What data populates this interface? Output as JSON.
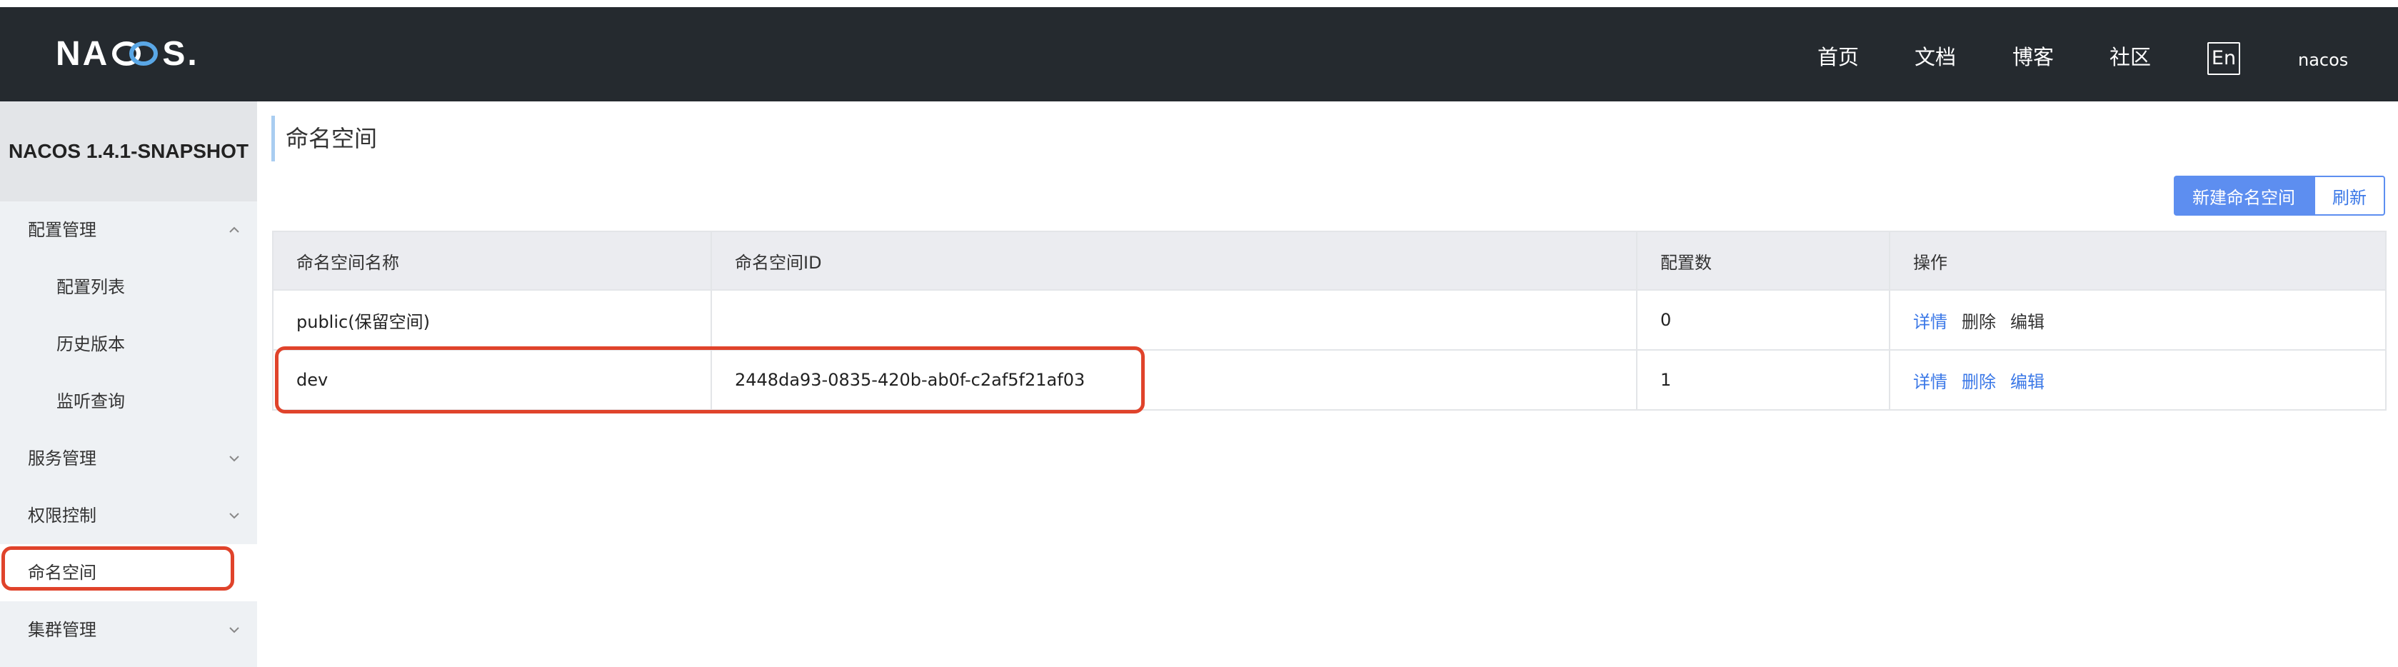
{
  "header": {
    "logo": "NACOS.",
    "nav": [
      "首页",
      "文档",
      "博客",
      "社区"
    ],
    "lang": "En",
    "user": "nacos"
  },
  "sidebar": {
    "version": "NACOS 1.4.1-SNAPSHOT",
    "items": [
      {
        "label": "配置管理",
        "expanded": true
      },
      {
        "label": "配置列表"
      },
      {
        "label": "历史版本"
      },
      {
        "label": "监听查询"
      },
      {
        "label": "服务管理",
        "expanded": false
      },
      {
        "label": "权限控制",
        "expanded": false
      },
      {
        "label": "命名空间",
        "active": true
      },
      {
        "label": "集群管理",
        "expanded": false
      }
    ]
  },
  "main": {
    "title": "命名空间",
    "buttons": {
      "new": "新建命名空间",
      "refresh": "刷新"
    },
    "table": {
      "columns": [
        "命名空间名称",
        "命名空间ID",
        "配置数",
        "操作"
      ],
      "rows": [
        {
          "name": "public(保留空间)",
          "id": "",
          "count": "0",
          "ops": [
            "详情",
            "删除",
            "编辑"
          ]
        },
        {
          "name": "dev",
          "id": "2448da93-0835-420b-ab0f-c2af5f21af03",
          "count": "1",
          "ops": [
            "详情",
            "删除",
            "编辑"
          ]
        }
      ]
    }
  },
  "colors": {
    "header_bg": "#252a2f",
    "primary": "#5d8ef0",
    "link": "#3b78e7",
    "highlight": "#e0432b",
    "sidebar_bg": "#eef1f4"
  }
}
